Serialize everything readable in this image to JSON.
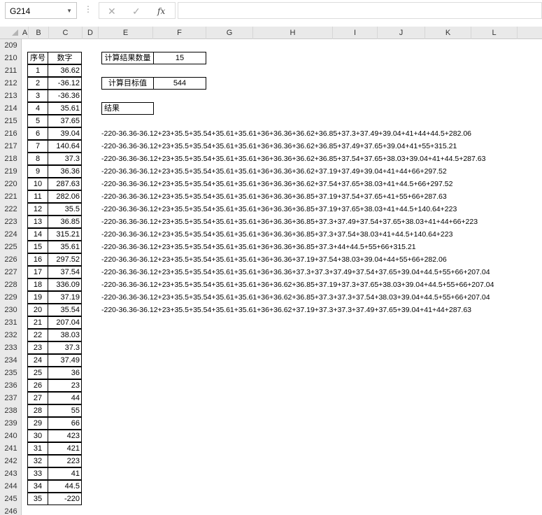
{
  "formula_bar": {
    "name_box": "G214",
    "cancel_icon": "✕",
    "enter_icon": "✓",
    "fx_label": "fx",
    "formula": ""
  },
  "columns": [
    "A",
    "B",
    "C",
    "D",
    "E",
    "F",
    "G",
    "H",
    "I",
    "J",
    "K",
    "L"
  ],
  "rows": [
    "209",
    "210",
    "211",
    "212",
    "213",
    "214",
    "215",
    "216",
    "217",
    "218",
    "219",
    "220",
    "221",
    "222",
    "223",
    "224",
    "225",
    "226",
    "227",
    "228",
    "229",
    "230",
    "231",
    "232",
    "233",
    "234",
    "235",
    "236",
    "237",
    "238",
    "239",
    "240",
    "241",
    "242",
    "243",
    "244",
    "245",
    "246"
  ],
  "table": {
    "header_index": "序号",
    "header_value": "数字",
    "rows": [
      {
        "index": "1",
        "value": "36.62"
      },
      {
        "index": "2",
        "value": "-36.12"
      },
      {
        "index": "3",
        "value": "-36.36"
      },
      {
        "index": "4",
        "value": "35.61"
      },
      {
        "index": "5",
        "value": "37.65"
      },
      {
        "index": "6",
        "value": "39.04"
      },
      {
        "index": "7",
        "value": "140.64"
      },
      {
        "index": "8",
        "value": "37.3"
      },
      {
        "index": "9",
        "value": "36.36"
      },
      {
        "index": "10",
        "value": "287.63"
      },
      {
        "index": "11",
        "value": "282.06"
      },
      {
        "index": "12",
        "value": "35.5"
      },
      {
        "index": "13",
        "value": "36.85"
      },
      {
        "index": "14",
        "value": "315.21"
      },
      {
        "index": "15",
        "value": "35.61"
      },
      {
        "index": "16",
        "value": "297.52"
      },
      {
        "index": "17",
        "value": "37.54"
      },
      {
        "index": "18",
        "value": "336.09"
      },
      {
        "index": "19",
        "value": "37.19"
      },
      {
        "index": "20",
        "value": "35.54"
      },
      {
        "index": "21",
        "value": "207.04"
      },
      {
        "index": "22",
        "value": "38.03"
      },
      {
        "index": "23",
        "value": "37.3"
      },
      {
        "index": "24",
        "value": "37.49"
      },
      {
        "index": "25",
        "value": "36"
      },
      {
        "index": "26",
        "value": "23"
      },
      {
        "index": "27",
        "value": "44"
      },
      {
        "index": "28",
        "value": "55"
      },
      {
        "index": "29",
        "value": "66"
      },
      {
        "index": "30",
        "value": "423"
      },
      {
        "index": "31",
        "value": "421"
      },
      {
        "index": "32",
        "value": "223"
      },
      {
        "index": "33",
        "value": "41"
      },
      {
        "index": "34",
        "value": "44.5"
      },
      {
        "index": "35",
        "value": "-220"
      }
    ]
  },
  "params": {
    "count_label": "计算结果数量",
    "count_value": "15",
    "target_label": "计算目标值",
    "target_value": "544",
    "result_label": "结果"
  },
  "results": [
    "-220-36.36-36.12+23+35.5+35.54+35.61+35.61+36+36.36+36.62+36.85+37.3+37.49+39.04+41+44+44.5+282.06",
    "-220-36.36-36.12+23+35.5+35.54+35.61+35.61+36+36.36+36.62+36.85+37.49+37.65+39.04+41+55+315.21",
    "-220-36.36-36.12+23+35.5+35.54+35.61+35.61+36+36.36+36.62+36.85+37.54+37.65+38.03+39.04+41+44.5+287.63",
    "-220-36.36-36.12+23+35.5+35.54+35.61+35.61+36+36.36+36.62+37.19+37.49+39.04+41+44+66+297.52",
    "-220-36.36-36.12+23+35.5+35.54+35.61+35.61+36+36.36+36.62+37.54+37.65+38.03+41+44.5+66+297.52",
    "-220-36.36-36.12+23+35.5+35.54+35.61+35.61+36+36.36+36.85+37.19+37.54+37.65+41+55+66+287.63",
    "-220-36.36-36.12+23+35.5+35.54+35.61+35.61+36+36.36+36.85+37.19+37.65+38.03+41+44.5+140.64+223",
    "-220-36.36-36.12+23+35.5+35.54+35.61+35.61+36+36.36+36.85+37.3+37.49+37.54+37.65+38.03+41+44+66+223",
    "-220-36.36-36.12+23+35.5+35.54+35.61+35.61+36+36.36+36.85+37.3+37.54+38.03+41+44.5+140.64+223",
    "-220-36.36-36.12+23+35.5+35.54+35.61+35.61+36+36.36+36.85+37.3+44+44.5+55+66+315.21",
    "-220-36.36-36.12+23+35.5+35.54+35.61+35.61+36+36.36+37.19+37.54+38.03+39.04+44+55+66+282.06",
    "-220-36.36-36.12+23+35.5+35.54+35.61+35.61+36+36.36+37.3+37.3+37.49+37.54+37.65+39.04+44.5+55+66+207.04",
    "-220-36.36-36.12+23+35.5+35.54+35.61+35.61+36+36.62+36.85+37.19+37.3+37.65+38.03+39.04+44.5+55+66+207.04",
    "-220-36.36-36.12+23+35.5+35.54+35.61+35.61+36+36.62+36.85+37.3+37.3+37.54+38.03+39.04+44.5+55+66+207.04",
    "-220-36.36-36.12+23+35.5+35.54+35.61+35.61+36+36.62+37.19+37.3+37.3+37.49+37.65+39.04+41+44+287.63"
  ]
}
